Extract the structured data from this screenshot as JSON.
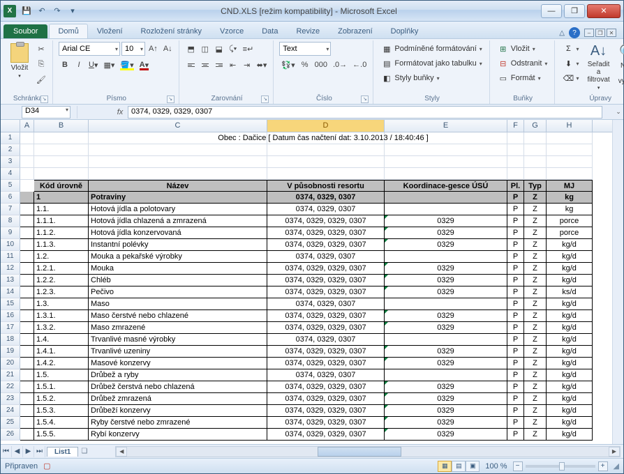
{
  "title": "CND.XLS  [režim kompatibility] - Microsoft Excel",
  "tabs": {
    "file": "Soubor",
    "home": "Domů",
    "insert": "Vložení",
    "layout": "Rozložení stránky",
    "formulas": "Vzorce",
    "data": "Data",
    "review": "Revize",
    "view": "Zobrazení",
    "addins": "Doplňky"
  },
  "ribbon": {
    "clipboard": {
      "paste": "Vložit",
      "label": "Schránka"
    },
    "font": {
      "name": "Arial CE",
      "size": "10",
      "label": "Písmo"
    },
    "align": {
      "label": "Zarovnání"
    },
    "number": {
      "format": "Text",
      "label": "Číslo"
    },
    "styles": {
      "cond": "Podmíněné formátování",
      "table": "Formátovat jako tabulku",
      "cellstyles": "Styly buňky",
      "label": "Styly"
    },
    "cells": {
      "insert": "Vložit",
      "delete": "Odstranit",
      "format": "Formát",
      "label": "Buňky"
    },
    "editing": {
      "sort": "Seřadit a filtrovat",
      "find": "Najít a vybrat",
      "label": "Úpravy"
    }
  },
  "namebox": "D34",
  "formula": "0374, 0329, 0329, 0307",
  "cols": [
    "A",
    "B",
    "C",
    "D",
    "E",
    "F",
    "G",
    "H"
  ],
  "caption": "Obec : Dačice [ Datum čas načtení dat: 3.10.2013 / 18:40:46 ]",
  "headers": {
    "b": "Kód úrovně",
    "c": "Název",
    "d": "V působnosti resortu",
    "e": "Koordinace-gesce ÚSÚ",
    "f": "Pl.",
    "g": "Typ",
    "h": "MJ"
  },
  "rows": [
    {
      "n": 6,
      "cat": true,
      "b": "1",
      "c": "Potraviny",
      "d": "0374, 0329, 0307",
      "e": "",
      "f": "P",
      "g": "Z",
      "h": "kg"
    },
    {
      "n": 7,
      "b": "1.1.",
      "c": "Hotová jídla a polotovary",
      "d": "0374, 0329, 0307",
      "e": "",
      "f": "P",
      "g": "Z",
      "h": "kg"
    },
    {
      "n": 8,
      "b": "1.1.1.",
      "c": "Hotová jídla chlazená  a zmrazená",
      "d": "0374, 0329, 0329, 0307",
      "e": "0329",
      "tri": true,
      "f": "P",
      "g": "Z",
      "h": "porce"
    },
    {
      "n": 9,
      "b": "1.1.2.",
      "c": "Hotová jídla konzervovaná",
      "d": "0374, 0329, 0329, 0307",
      "e": "0329",
      "tri": true,
      "f": "P",
      "g": "Z",
      "h": "porce"
    },
    {
      "n": 10,
      "b": "1.1.3.",
      "c": "Instantní polévky",
      "d": "0374, 0329, 0329, 0307",
      "e": "0329",
      "tri": true,
      "f": "P",
      "g": "Z",
      "h": "kg/d"
    },
    {
      "n": 11,
      "b": "1.2.",
      "c": "Mouka a pekařské výrobky",
      "d": "0374, 0329, 0307",
      "e": "",
      "f": "P",
      "g": "Z",
      "h": "kg/d"
    },
    {
      "n": 12,
      "b": "1.2.1.",
      "c": "Mouka",
      "d": "0374, 0329, 0329, 0307",
      "e": "0329",
      "tri": true,
      "f": "P",
      "g": "Z",
      "h": "kg/d"
    },
    {
      "n": 13,
      "b": "1.2.2.",
      "c": "Chléb",
      "d": "0374, 0329, 0329, 0307",
      "e": "0329",
      "tri": true,
      "f": "P",
      "g": "Z",
      "h": "kg/d"
    },
    {
      "n": 14,
      "b": "1.2.3.",
      "c": "Pečivo",
      "d": "0374, 0329, 0329, 0307",
      "e": "0329",
      "tri": true,
      "f": "P",
      "g": "Z",
      "h": "ks/d"
    },
    {
      "n": 15,
      "b": "1.3.",
      "c": "Maso",
      "d": "0374, 0329, 0307",
      "e": "",
      "f": "P",
      "g": "Z",
      "h": "kg/d"
    },
    {
      "n": 16,
      "b": "1.3.1.",
      "c": "Maso čerstvé nebo chlazené",
      "d": "0374, 0329, 0329, 0307",
      "e": "0329",
      "tri": true,
      "f": "P",
      "g": "Z",
      "h": "kg/d"
    },
    {
      "n": 17,
      "b": "1.3.2.",
      "c": "Maso zmrazené",
      "d": "0374, 0329, 0329, 0307",
      "e": "0329",
      "tri": true,
      "f": "P",
      "g": "Z",
      "h": "kg/d"
    },
    {
      "n": 18,
      "b": "1.4.",
      "c": "Trvanlivé masné výrobky",
      "d": "0374, 0329, 0307",
      "e": "",
      "f": "P",
      "g": "Z",
      "h": "kg/d"
    },
    {
      "n": 19,
      "b": "1.4.1.",
      "c": "Trvanlivé uzeniny",
      "d": "0374, 0329, 0329, 0307",
      "e": "0329",
      "tri": true,
      "f": "P",
      "g": "Z",
      "h": "kg/d"
    },
    {
      "n": 20,
      "b": "1.4.2.",
      "c": "Masové konzervy",
      "d": "0374, 0329, 0329, 0307",
      "e": "0329",
      "tri": true,
      "f": "P",
      "g": "Z",
      "h": "kg/d"
    },
    {
      "n": 21,
      "b": "1.5.",
      "c": "Drůbež a ryby",
      "d": "0374, 0329, 0307",
      "e": "",
      "f": "P",
      "g": "Z",
      "h": "kg/d"
    },
    {
      "n": 22,
      "b": "1.5.1.",
      "c": "Drůbež čerstvá nebo chlazená",
      "d": "0374, 0329, 0329, 0307",
      "e": "0329",
      "tri": true,
      "f": "P",
      "g": "Z",
      "h": "kg/d"
    },
    {
      "n": 23,
      "b": "1.5.2.",
      "c": "Drůbež zmrazená",
      "d": "0374, 0329, 0329, 0307",
      "e": "0329",
      "tri": true,
      "f": "P",
      "g": "Z",
      "h": "kg/d"
    },
    {
      "n": 24,
      "b": "1.5.3.",
      "c": "Drůbeží konzervy",
      "d": "0374, 0329, 0329, 0307",
      "e": "0329",
      "tri": true,
      "f": "P",
      "g": "Z",
      "h": "kg/d"
    },
    {
      "n": 25,
      "b": "1.5.4.",
      "c": "Ryby čerstvé nebo zmrazené",
      "d": "0374, 0329, 0329, 0307",
      "e": "0329",
      "tri": true,
      "f": "P",
      "g": "Z",
      "h": "kg/d"
    },
    {
      "n": 26,
      "b": "1.5.5.",
      "c": "Rybí konzervy",
      "d": "0374, 0329, 0329, 0307",
      "e": "0329",
      "tri": true,
      "f": "P",
      "g": "Z",
      "h": "kg/d"
    }
  ],
  "sheet": "List1",
  "status": {
    "ready": "Připraven",
    "zoom": "100 %"
  }
}
